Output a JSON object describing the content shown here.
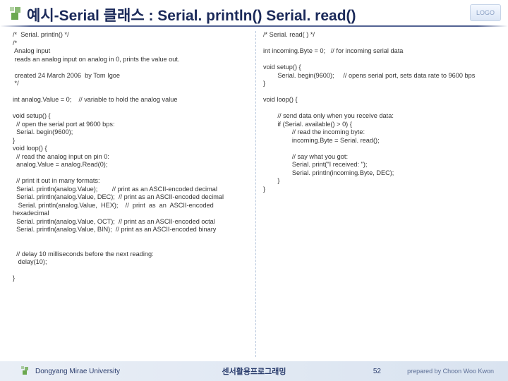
{
  "header": {
    "title": "예시-Serial 클래스 : Serial. println() Serial. read()",
    "logo_text": "LOGO"
  },
  "code": {
    "left": "/*  Serial. println() */\n/*\n Analog input\n reads an analog input on analog in 0, prints the value out.\n\n created 24 March 2006  by Tom Igoe\n */\n\nint analog.Value = 0;    // variable to hold the analog value\n\nvoid setup() {\n  // open the serial port at 9600 bps:\n  Serial. begin(9600);\n}\nvoid loop() {\n  // read the analog input on pin 0:\n  analog.Value = analog.Read(0);\n\n  // print it out in many formats:\n  Serial. println(analog.Value);        // print as an ASCII-encoded decimal\n  Serial. println(analog.Value, DEC);  // print as an ASCII-encoded decimal\n   Serial. println(analog.Value,  HEX);    //  print  as  an  ASCII-encoded\nhexadecimal\n  Serial. println(analog.Value, OCT);  // print as an ASCII-encoded octal\n  Serial. println(analog.Value, BIN);  // print as an ASCII-encoded binary\n\n\n  // delay 10 milliseconds before the next reading:\n   delay(10);\n\n}",
    "right": "/* Serial. read( ) */\n\nint incoming.Byte = 0;   // for incoming serial data\n\nvoid setup() {\n        Serial. begin(9600);     // opens serial port, sets data rate to 9600 bps\n}\n\nvoid loop() {\n\n        // send data only when you receive data:\n        if (Serial. available() > 0) {\n                // read the incoming byte:\n                incoming.Byte = Serial. read();\n\n                // say what you got:\n                Serial. print(\"I received: \");\n                Serial. println(incoming.Byte, DEC);\n        }\n}"
  },
  "footer": {
    "left": "Dongyang Mirae University",
    "center": "센서활용프로그래밍",
    "page": "52",
    "right": "prepared by Choon Woo Kwon"
  }
}
